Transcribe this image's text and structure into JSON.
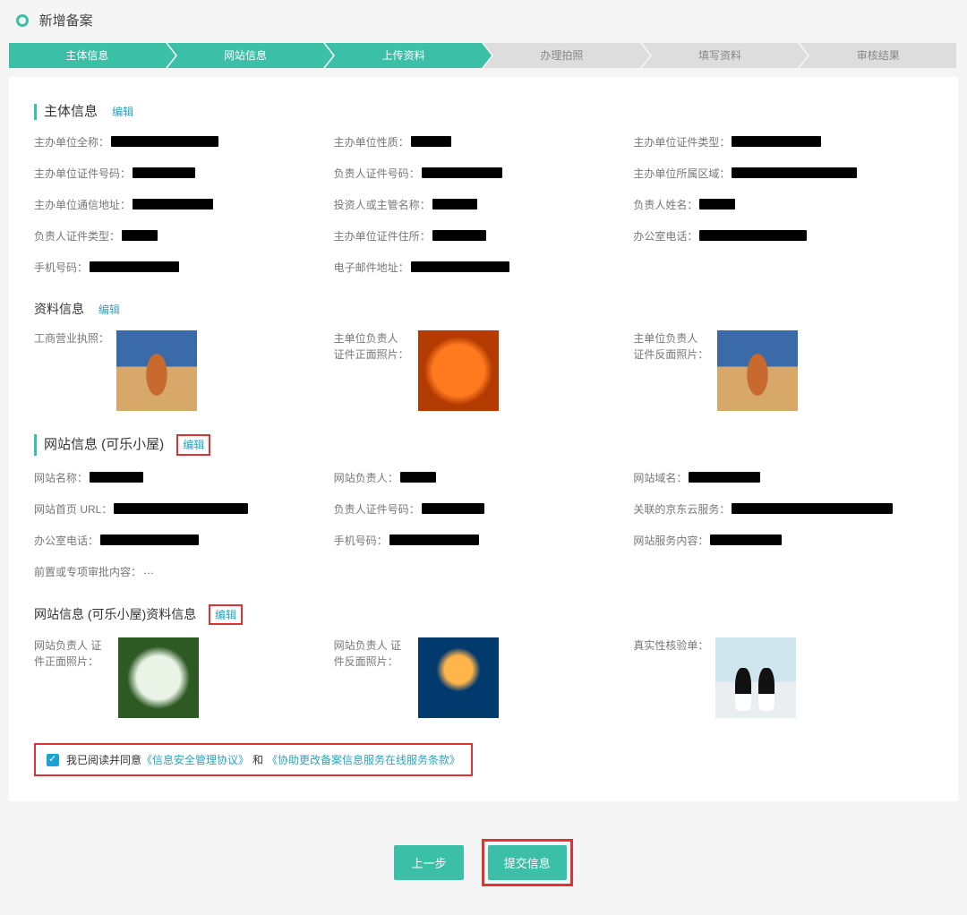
{
  "page": {
    "title": "新增备案"
  },
  "steps": [
    {
      "label": "主体信息",
      "active": true
    },
    {
      "label": "网站信息",
      "active": true
    },
    {
      "label": "上传资料",
      "active": true
    },
    {
      "label": "办理拍照",
      "active": false
    },
    {
      "label": "填写资料",
      "active": false
    },
    {
      "label": "审核结果",
      "active": false
    }
  ],
  "section_main": {
    "title": "主体信息",
    "edit": "编辑",
    "col1": [
      {
        "label": "主办单位全称",
        "mask_w": 120
      },
      {
        "label": "主办单位证件号码",
        "mask_w": 70
      },
      {
        "label": "主办单位通信地址",
        "mask_w": 90
      },
      {
        "label": "负责人证件类型",
        "mask_w": 40
      },
      {
        "label": "手机号码",
        "mask_w": 100
      }
    ],
    "col2": [
      {
        "label": "主办单位性质",
        "mask_w": 45
      },
      {
        "label": "负责人证件号码",
        "mask_w": 90
      },
      {
        "label": "投资人或主管名称",
        "mask_w": 50
      },
      {
        "label": "主办单位证件住所",
        "mask_w": 60
      },
      {
        "label": "电子邮件地址",
        "mask_w": 110
      }
    ],
    "col3": [
      {
        "label": "主办单位证件类型",
        "mask_w": 100
      },
      {
        "label": "主办单位所属区域",
        "mask_w": 140
      },
      {
        "label": "负责人姓名",
        "mask_w": 40
      },
      {
        "label": "办公室电话",
        "mask_w": 120
      }
    ]
  },
  "material_head": {
    "title": "资料信息",
    "edit": "编辑"
  },
  "material_imgs": [
    {
      "label": "工商营业执照：",
      "thumb": "desert"
    },
    {
      "label": "主单位负责人\n证件正面照片：",
      "thumb": "flower-orange"
    },
    {
      "label": "主单位负责人\n证件反面照片：",
      "thumb": "desert"
    }
  ],
  "section_site": {
    "title": "网站信息 (可乐小屋)",
    "edit": "编辑",
    "col1": [
      {
        "label": "网站名称",
        "mask_w": 60
      },
      {
        "label": "网站首页 URL",
        "mask_w": 150
      },
      {
        "label": "办公室电话",
        "mask_w": 110
      },
      {
        "label": "前置或专项审批内容",
        "text": "…"
      }
    ],
    "col2": [
      {
        "label": "网站负责人",
        "mask_w": 40
      },
      {
        "label": "负责人证件号码",
        "mask_w": 70
      },
      {
        "label": "手机号码",
        "mask_w": 100
      }
    ],
    "col3": [
      {
        "label": "网站域名",
        "mask_w": 80
      },
      {
        "label": "关联的京东云服务",
        "mask_w": 180
      },
      {
        "label": "网站服务内容",
        "mask_w": 80
      }
    ]
  },
  "site_material_head": {
    "title": "网站信息 (可乐小屋)资料信息",
    "edit": "编辑"
  },
  "site_imgs": [
    {
      "label": "网站负责人\n证件正面照片：",
      "thumb": "flower-white"
    },
    {
      "label": "网站负责人\n证件反面照片：",
      "thumb": "jelly"
    },
    {
      "label": "真实性核验单：",
      "thumb": "penguin"
    }
  ],
  "agree": {
    "text": "我已阅读并同意",
    "link1": "《信息安全管理协议》",
    "and": "和",
    "link2": "《协助更改备案信息服务在线服务条款》"
  },
  "buttons": {
    "prev": "上一步",
    "submit": "提交信息"
  }
}
